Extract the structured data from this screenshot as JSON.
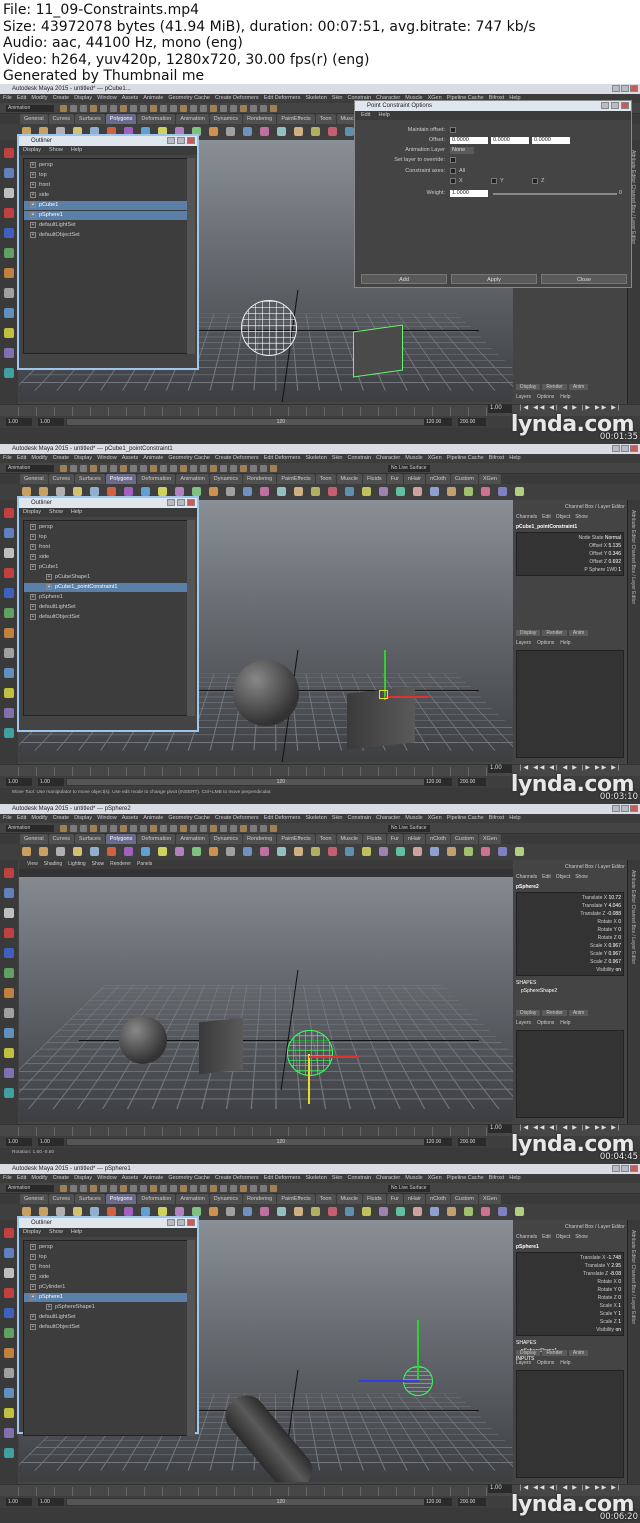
{
  "header": {
    "file": "File: 11_09-Constraints.mp4",
    "size": "Size: 43972078 bytes (41.94 MiB), duration: 00:07:51, avg.bitrate: 747 kb/s",
    "audio": "Audio: aac, 44100 Hz, mono (eng)",
    "video": "Video: h264, yuv420p, 1280x720, 30.00 fps(r) (eng)",
    "generated": "Generated by Thumbnail me"
  },
  "menus": [
    "File",
    "Edit",
    "Modify",
    "Create",
    "Display",
    "Window",
    "Assets",
    "Animate",
    "Geometry Cache",
    "Create Deformers",
    "Edit Deformers",
    "Skeleton",
    "Skin",
    "Constrain",
    "Character",
    "Muscle",
    "XGen",
    "Pipeline Cache",
    "Bifrost",
    "Help"
  ],
  "shelf_tabs": [
    "General",
    "Curves",
    "Surfaces",
    "Polygons",
    "Deformation",
    "Animation",
    "Dynamics",
    "Rendering",
    "PaintEffects",
    "Toon",
    "Muscle",
    "Fluids",
    "Fur",
    "nHair",
    "nCloth",
    "Custom",
    "XGen"
  ],
  "mode": "Animation",
  "no_live": "No Live Surface",
  "watermark": "lynda.com",
  "frames": [
    {
      "title": "Autodesk Maya 2015 - untitled* --- pCube1...",
      "timestamp": "00:01:35",
      "range_start": "1.00",
      "range_start2": "1.00",
      "range_end": "120",
      "range_end2": "120.00",
      "range_end3": "200.00",
      "current": "1.00",
      "help": "",
      "outliner": {
        "title": "Outliner",
        "menu": [
          "Display",
          "Show",
          "Help"
        ],
        "items": [
          {
            "label": "persp",
            "sel": false,
            "indent": 0
          },
          {
            "label": "top",
            "sel": false,
            "indent": 0
          },
          {
            "label": "front",
            "sel": false,
            "indent": 0
          },
          {
            "label": "side",
            "sel": false,
            "indent": 0
          },
          {
            "label": "pCube1",
            "sel": true,
            "indent": 0
          },
          {
            "label": "pSphere1",
            "sel": true,
            "indent": 0
          },
          {
            "label": "defaultLightSet",
            "sel": false,
            "indent": 0
          },
          {
            "label": "defaultObjectSet",
            "sel": false,
            "indent": 0
          }
        ]
      },
      "point_constraint": {
        "title": "Point Constraint Options",
        "menu": [
          "Edit",
          "Help"
        ],
        "maintain_offset": "Maintain offset:",
        "offset": "Offset:",
        "offset_values": [
          "0.0000",
          "0.0000",
          "0.0000"
        ],
        "animation_layer": "Animation Layer",
        "animation_layer_value": "None",
        "set_layer": "Set layer to override:",
        "constraint_axes": "Constraint axes:",
        "all": "All",
        "x": "X",
        "y": "Y",
        "z": "Z",
        "weight": "Weight:",
        "weight_value": "1.0000",
        "weight_max": "0",
        "buttons": [
          "Add",
          "Apply",
          "Close"
        ]
      },
      "side": {
        "shape": "pCubeShape1",
        "inputs": "INPUTS",
        "tabs": [
          "Display",
          "Render",
          "Anim"
        ],
        "layer_menu": [
          "Layers",
          "Options",
          "Help"
        ]
      }
    },
    {
      "title": "Autodesk Maya 2015 - untitled* --- pCube1_pointConstraint1",
      "timestamp": "00:03:10",
      "range_start": "1.00",
      "range_start2": "1.00",
      "range_end": "120",
      "range_end2": "120.00",
      "range_end3": "200.00",
      "current": "1.00",
      "help": "Move Tool: Use manipulator to move object(s). Use edit mode to change pivot (INSERT). Ctrl+LMB to move perpendicular.",
      "outliner": {
        "title": "Outliner",
        "menu": [
          "Display",
          "Show",
          "Help"
        ],
        "items": [
          {
            "label": "persp",
            "sel": false,
            "indent": 0
          },
          {
            "label": "top",
            "sel": false,
            "indent": 0
          },
          {
            "label": "front",
            "sel": false,
            "indent": 0
          },
          {
            "label": "side",
            "sel": false,
            "indent": 0
          },
          {
            "label": "pCube1",
            "sel": false,
            "indent": 0
          },
          {
            "label": "pCubeShape1",
            "sel": false,
            "indent": 1
          },
          {
            "label": "pCube1_pointConstraint1",
            "sel": true,
            "indent": 1
          },
          {
            "label": "pSphere1",
            "sel": false,
            "indent": 0
          },
          {
            "label": "defaultLightSet",
            "sel": false,
            "indent": 0
          },
          {
            "label": "defaultObjectSet",
            "sel": false,
            "indent": 0
          }
        ]
      },
      "side": {
        "header": "Channel Box / Layer Editor",
        "menu": [
          "Channels",
          "Edit",
          "Object",
          "Show"
        ],
        "node": "pCube1_pointConstraint1",
        "attrs": [
          {
            "name": "Node State",
            "value": "Normal"
          },
          {
            "name": "Offset X",
            "value": "5.135"
          },
          {
            "name": "Offset Y",
            "value": "0.346"
          },
          {
            "name": "Offset Z",
            "value": "0.692"
          },
          {
            "name": "P Sphere 1W0",
            "value": "1"
          }
        ],
        "tabs": [
          "Display",
          "Render",
          "Anim"
        ],
        "layer_menu": [
          "Layers",
          "Options",
          "Help"
        ]
      }
    },
    {
      "title": "Autodesk Maya 2015 - untitled* --- pSphere2",
      "timestamp": "00:04:45",
      "range_start": "1.00",
      "range_start2": "1.00",
      "range_end": "120",
      "range_end2": "120.00",
      "range_end3": "200.00",
      "current": "1.00",
      "help": "Rotation:  1.60   -0.60",
      "viewport_menu": [
        "View",
        "Shading",
        "Lighting",
        "Show",
        "Renderer",
        "Panels"
      ],
      "side": {
        "header": "Channel Box / Layer Editor",
        "menu": [
          "Channels",
          "Edit",
          "Object",
          "Show"
        ],
        "node": "pSphere2",
        "attrs": [
          {
            "name": "Translate X",
            "value": "10.72"
          },
          {
            "name": "Translate Y",
            "value": "4.046"
          },
          {
            "name": "Translate Z",
            "value": "-0.088"
          },
          {
            "name": "Rotate X",
            "value": "0"
          },
          {
            "name": "Rotate Y",
            "value": "0"
          },
          {
            "name": "Rotate Z",
            "value": "0"
          },
          {
            "name": "Scale X",
            "value": "0.967"
          },
          {
            "name": "Scale Y",
            "value": "0.967"
          },
          {
            "name": "Scale Z",
            "value": "0.967"
          },
          {
            "name": "Visibility",
            "value": "on"
          }
        ],
        "shapes": "SHAPES",
        "shape": "pSphereShape2",
        "tabs": [
          "Display",
          "Render",
          "Anim"
        ],
        "layer_menu": [
          "Layers",
          "Options",
          "Help"
        ]
      }
    },
    {
      "title": "Autodesk Maya 2015 - untitled* --- pSphere1",
      "timestamp": "00:06:20",
      "range_start": "1.00",
      "range_start2": "1.00",
      "range_end": "120",
      "range_end2": "120.00",
      "range_end3": "200.00",
      "current": "1.00",
      "help": "",
      "outliner": {
        "title": "Outliner",
        "menu": [
          "Display",
          "Show",
          "Help"
        ],
        "items": [
          {
            "label": "persp",
            "sel": false,
            "indent": 0
          },
          {
            "label": "top",
            "sel": false,
            "indent": 0
          },
          {
            "label": "front",
            "sel": false,
            "indent": 0
          },
          {
            "label": "side",
            "sel": false,
            "indent": 0
          },
          {
            "label": "pCylinder1",
            "sel": false,
            "indent": 0
          },
          {
            "label": "pSphere1",
            "sel": true,
            "indent": 0
          },
          {
            "label": "pSphereShape1",
            "sel": false,
            "indent": 1
          },
          {
            "label": "defaultLightSet",
            "sel": false,
            "indent": 0
          },
          {
            "label": "defaultObjectSet",
            "sel": false,
            "indent": 0
          }
        ]
      },
      "side": {
        "header": "Channel Box / Layer Editor",
        "menu": [
          "Channels",
          "Edit",
          "Object",
          "Show"
        ],
        "node": "pSphere1",
        "attrs": [
          {
            "name": "Translate X",
            "value": "-1.748"
          },
          {
            "name": "Translate Y",
            "value": "2.95"
          },
          {
            "name": "Translate Z",
            "value": "-8.08"
          },
          {
            "name": "Rotate X",
            "value": "0"
          },
          {
            "name": "Rotate Y",
            "value": "0"
          },
          {
            "name": "Rotate Z",
            "value": "0"
          },
          {
            "name": "Scale X",
            "value": "1"
          },
          {
            "name": "Scale Y",
            "value": "1"
          },
          {
            "name": "Scale Z",
            "value": "1"
          },
          {
            "name": "Visibility",
            "value": "on"
          }
        ],
        "shapes": "SHAPES",
        "shape": "pSphereShape1",
        "inputs": "INPUTS",
        "tabs": [
          "Display",
          "Render",
          "Anim"
        ],
        "layer_menu": [
          "Layers",
          "Options",
          "Help"
        ]
      }
    }
  ],
  "colors": {
    "selection": "#5a7fa8",
    "outliner_border": "#9ec6ea",
    "wireframe_green": "#39ff5a",
    "manip_red": "#e03030",
    "manip_green": "#30d030",
    "manip_blue": "#3040e0",
    "manip_yellow": "#e8e020"
  }
}
